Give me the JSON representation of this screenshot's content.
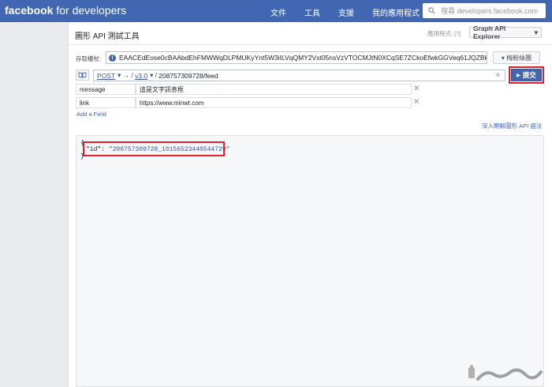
{
  "header": {
    "logo_bold": "facebook",
    "logo_rest": "for developers",
    "nav": [
      "文件",
      "工具",
      "支援",
      "我的應用程式"
    ],
    "search_placeholder": "搜尋 developers.facebook.com"
  },
  "explorer": {
    "title": "圖形 API 測試工具",
    "app_label": "應用程式: [?]",
    "app_value": "Graph API Explorer",
    "token_label": "存取權杖:",
    "token_value": "EAACEdEose0cBAAbdEhFMWWqDLPMUKyYnt5W3iILVqQMY2Vst05nsVzVTOCMJtN0XCqSE7ZCkoEfwkGGVeq61JQZBkyuIsYI9",
    "token_button": "▾ 梅粉絲團",
    "method": "POST",
    "version": "v3.0",
    "path": "208757309728/feed",
    "submit_label": "提交",
    "fields": [
      {
        "name": "message",
        "value": "這是文字訊息框"
      },
      {
        "name": "link",
        "value": "https://www.minwt.com"
      }
    ],
    "add_field": "Add a Field",
    "learn_link": "深入瞭解圖形 API 語法"
  },
  "result": {
    "open": "{",
    "key": "\"id\"",
    "colon": ": ",
    "value": "\"208757309728_10156523440544729\"",
    "close": "}"
  },
  "colors": {
    "topbar": "#4267b2",
    "highlight": "#e0202a"
  }
}
